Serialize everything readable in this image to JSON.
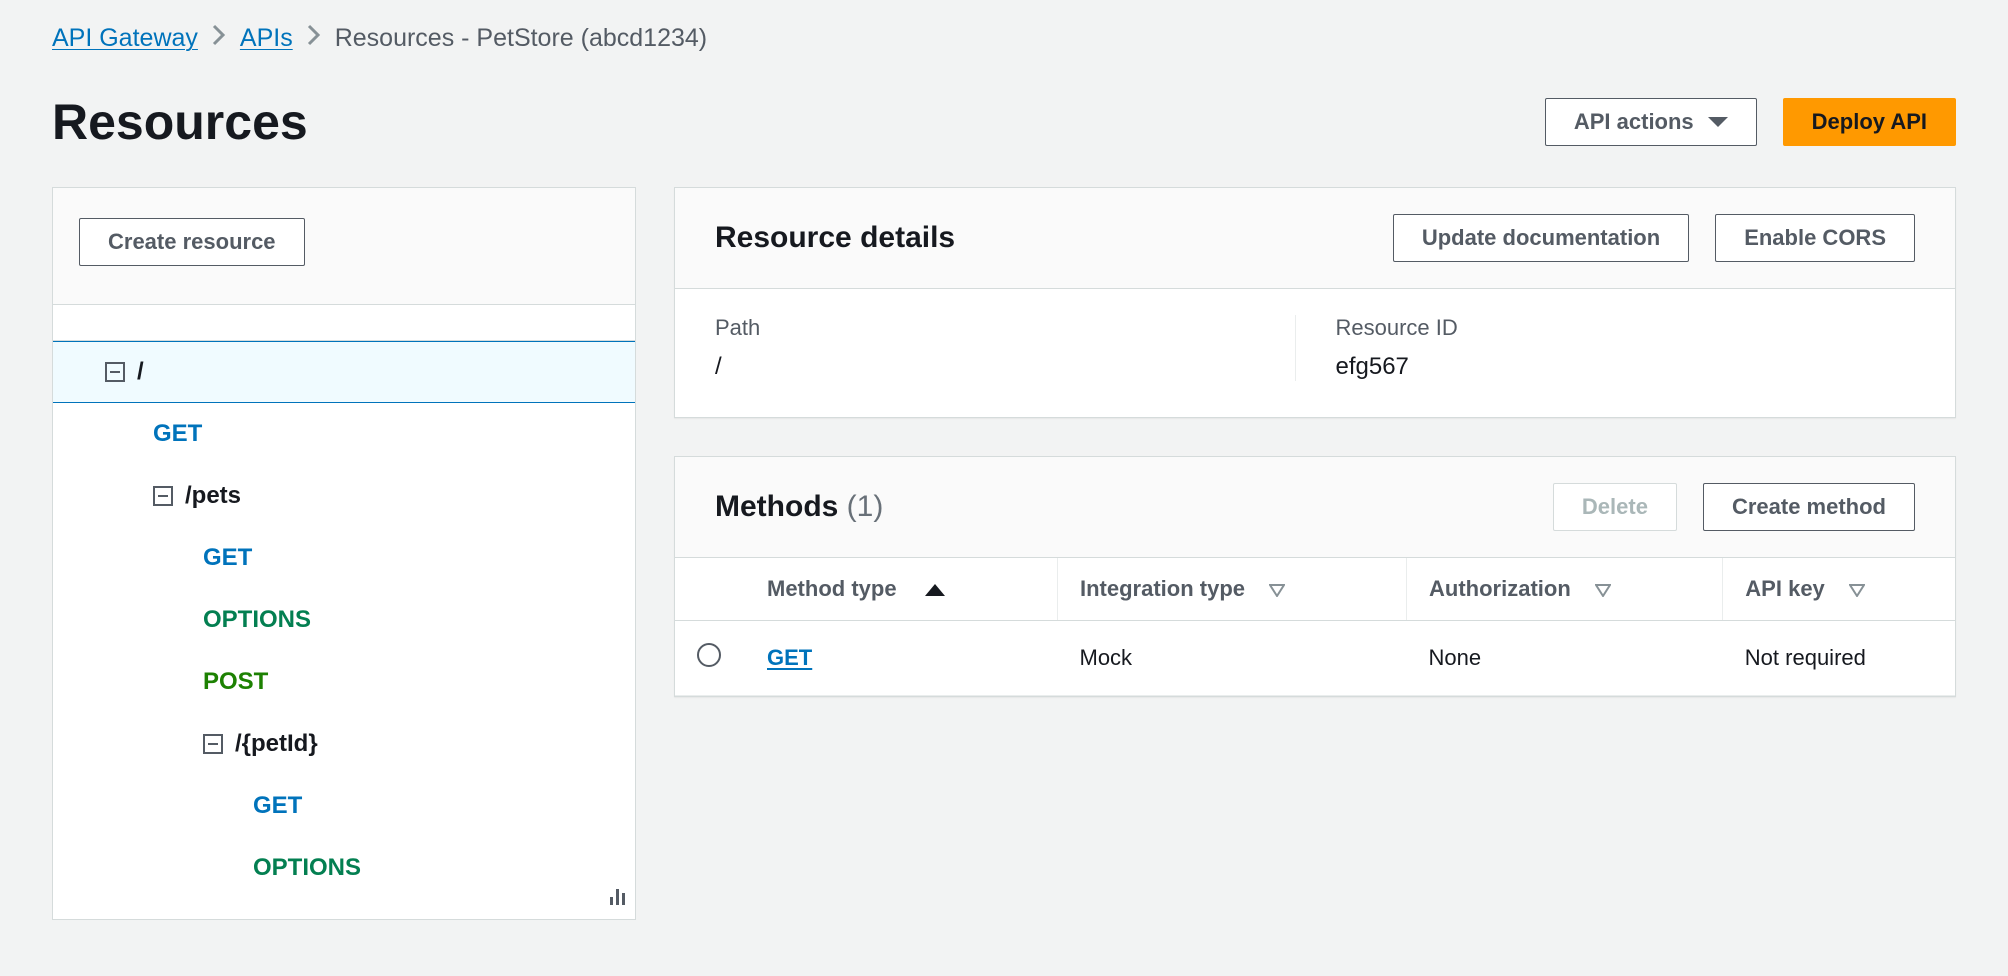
{
  "breadcrumbs": {
    "items": [
      {
        "label": "API Gateway",
        "link": true
      },
      {
        "label": "APIs",
        "link": true
      },
      {
        "label": "Resources - PetStore (abcd1234)",
        "link": false
      }
    ]
  },
  "header": {
    "title": "Resources",
    "api_actions_label": "API actions",
    "deploy_label": "Deploy API"
  },
  "sidebar": {
    "create_resource_label": "Create resource",
    "tree": {
      "root": "/",
      "root_methods": [
        "GET"
      ],
      "pets": "/pets",
      "pets_methods": [
        "GET",
        "OPTIONS",
        "POST"
      ],
      "petid": "/{petId}",
      "petid_methods": [
        "GET",
        "OPTIONS"
      ]
    }
  },
  "details": {
    "title": "Resource details",
    "update_doc_label": "Update documentation",
    "enable_cors_label": "Enable CORS",
    "path_label": "Path",
    "path_value": "/",
    "resource_id_label": "Resource ID",
    "resource_id_value": "efg567"
  },
  "methods": {
    "title": "Methods",
    "count": "(1)",
    "delete_label": "Delete",
    "create_method_label": "Create method",
    "columns": {
      "method_type": "Method type",
      "integration_type": "Integration type",
      "authorization": "Authorization",
      "api_key": "API key"
    },
    "rows": [
      {
        "method": "GET",
        "integration": "Mock",
        "authorization": "None",
        "api_key": "Not required"
      }
    ]
  }
}
